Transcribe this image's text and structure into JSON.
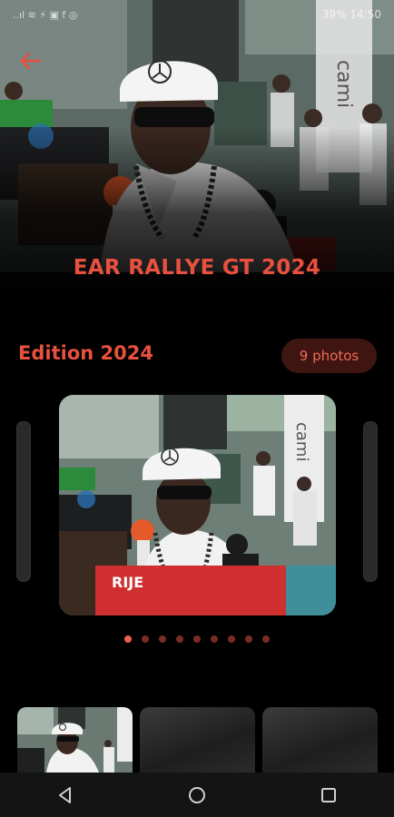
{
  "statusbar": {
    "left_icons": "..ıl ≋ ⚡ ▣ f ◎",
    "right_text": "39% 14:50"
  },
  "hero": {
    "title": "EAR RALLYE GT 2024",
    "banner_text": "cami"
  },
  "edition": {
    "title": "Edition 2024",
    "photo_count": "9 photos"
  },
  "carousel": {
    "banner_text": "cami",
    "sign_text": "RIJE",
    "dots": [
      true,
      false,
      false,
      false,
      false,
      false,
      false,
      false,
      false
    ]
  },
  "colors": {
    "accent": "#e8503f",
    "badge_bg": "#3f1511",
    "dot_inactive": "#7a2c24"
  },
  "icons": {
    "back": "arrow-left-icon",
    "nav_back": "triangle-back-icon",
    "nav_home": "circle-home-icon",
    "nav_recents": "square-recents-icon"
  }
}
